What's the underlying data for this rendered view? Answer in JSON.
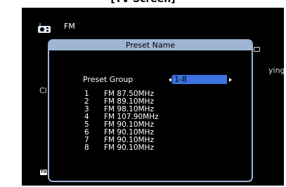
{
  "caption": "[TV Screen]",
  "source": {
    "icon": "radio-icon",
    "label": "FM"
  },
  "background": {
    "left_text": "Cl",
    "right_text": "ying"
  },
  "dialog": {
    "title": "Preset Name",
    "group_label": "Preset Group",
    "group_value": "1-8",
    "presets": [
      {
        "num": "1",
        "station": "FM 87.50MHz"
      },
      {
        "num": "2",
        "station": "FM 89.10MHz"
      },
      {
        "num": "3",
        "station": "FM 98.10MHz"
      },
      {
        "num": "4",
        "station": "FM 107.90MHz"
      },
      {
        "num": "5",
        "station": "FM 90.10MHz"
      },
      {
        "num": "6",
        "station": "FM 90.10MHz"
      },
      {
        "num": "7",
        "station": "FM 90.10MHz"
      },
      {
        "num": "8",
        "station": "FM 90.10MHz"
      }
    ]
  },
  "badge": "TU",
  "colors": {
    "title_bar": "#9fb6d3",
    "selection": "#3b73e1",
    "screen": "#000000"
  }
}
